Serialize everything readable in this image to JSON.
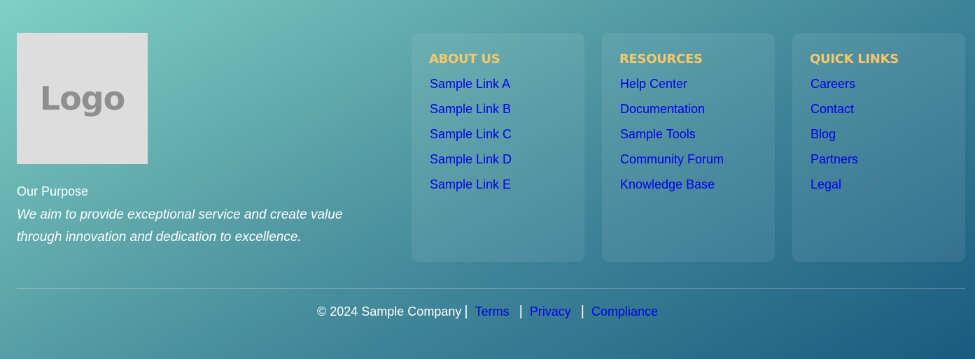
{
  "brand": {
    "logo_text": "Logo"
  },
  "purpose": {
    "title": "Our Purpose",
    "text": "We aim to provide exceptional service and create value through innovation and dedication to excellence."
  },
  "columns": [
    {
      "title": "ABOUT US",
      "links": [
        "Sample Link A",
        "Sample Link B",
        "Sample Link C",
        "Sample Link D",
        "Sample Link E"
      ]
    },
    {
      "title": "RESOURCES",
      "links": [
        "Help Center",
        "Documentation",
        "Sample Tools",
        "Community Forum",
        "Knowledge Base"
      ]
    },
    {
      "title": "QUICK LINKS",
      "links": [
        "Careers",
        "Contact",
        "Blog",
        "Partners",
        "Legal"
      ]
    }
  ],
  "footer": {
    "copyright": "© 2024 Sample Company",
    "separator": "|",
    "links": [
      "Terms",
      "Privacy",
      "Compliance"
    ]
  },
  "colors": {
    "heading_accent": "#f7c86a",
    "link": "#0000ee",
    "logo_placeholder_bg": "#dddddd",
    "gradient_start": "#7fd0c6",
    "gradient_end": "#1a5a80"
  }
}
